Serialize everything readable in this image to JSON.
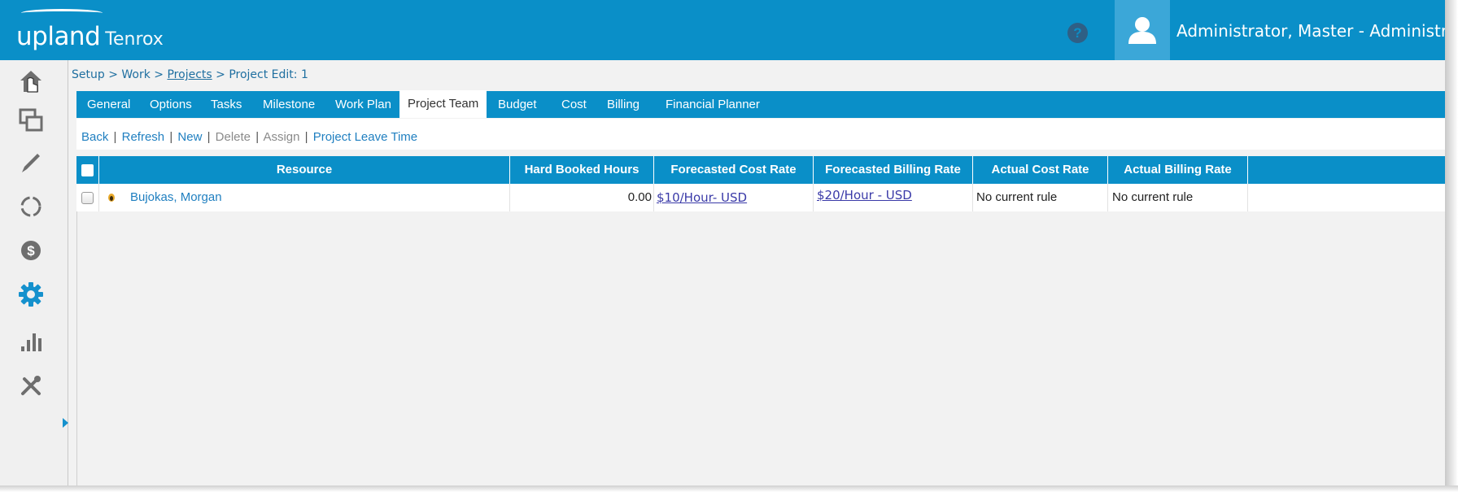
{
  "header": {
    "brand": "upland",
    "product": "Tenrox",
    "help_icon": "question-circle-icon",
    "user_icon": "user-icon",
    "user_name": "Administrator, Master - Administrat",
    "colors": {
      "primary": "#0a8fc8",
      "accent": "#3ba7d8"
    }
  },
  "leftnav": {
    "items": [
      {
        "icon": "home-icon"
      },
      {
        "icon": "windows-icon"
      },
      {
        "icon": "pencil-icon"
      },
      {
        "icon": "refresh-circle-icon"
      },
      {
        "icon": "dollar-icon"
      },
      {
        "icon": "gear-icon",
        "active": true
      },
      {
        "icon": "bar-chart-icon"
      },
      {
        "icon": "tools-icon"
      }
    ]
  },
  "breadcrumb": {
    "setup": "Setup",
    "work": "Work",
    "projects": "Projects",
    "current": "Project Edit: 1",
    "separator": ">"
  },
  "tabs": [
    {
      "label": "General"
    },
    {
      "label": "Options"
    },
    {
      "label": "Tasks"
    },
    {
      "label": "Milestone"
    },
    {
      "label": "Work Plan"
    },
    {
      "label": "Project Team",
      "active": true
    },
    {
      "label": "Budget"
    },
    {
      "label": "Cost"
    },
    {
      "label": "Billing"
    },
    {
      "label": "Financial Planner"
    }
  ],
  "actions": {
    "back": "Back",
    "refresh": "Refresh",
    "new": "New",
    "delete": "Delete",
    "assign": "Assign",
    "leave": "Project Leave Time",
    "separator": "|"
  },
  "table": {
    "columns": [
      "Resource",
      "Hard Booked Hours",
      "Forecasted Cost Rate",
      "Forecasted Billing Rate",
      "Actual Cost Rate",
      "Actual Billing Rate"
    ],
    "rows": [
      {
        "resource": "Bujokas, Morgan",
        "hard_booked_hours": "0.00",
        "forecasted_cost_rate": "$10/Hour- USD",
        "forecasted_billing_rate": "$20/Hour - USD",
        "actual_cost_rate": "No current rule",
        "actual_billing_rate": "No current rule"
      }
    ]
  }
}
